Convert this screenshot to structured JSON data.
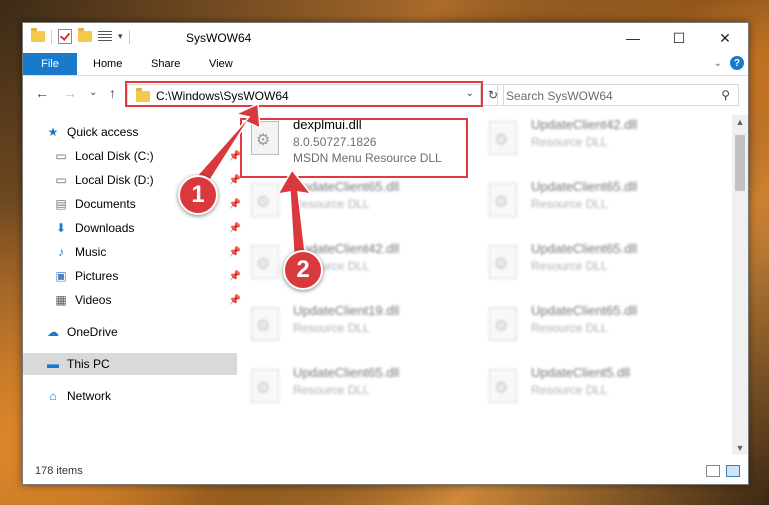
{
  "window": {
    "title": "SysWOW64",
    "controls": {
      "minimize": "—",
      "maximize": "☐",
      "close": "✕"
    }
  },
  "ribbon": {
    "tabs": [
      {
        "label": "File"
      },
      {
        "label": "Home"
      },
      {
        "label": "Share"
      },
      {
        "label": "View"
      }
    ],
    "help_label": "?",
    "collapse_glyph": "⌄"
  },
  "nav": {
    "back": "←",
    "forward": "→",
    "recent": "⌄",
    "up": "↑",
    "address": "C:\\Windows\\SysWOW64",
    "address_chevron": "⌄",
    "refresh": "↻",
    "search_placeholder": "Search SysWOW64",
    "search_glyph": "⚲"
  },
  "sidebar": {
    "items": [
      {
        "label": "Quick access",
        "icon": "star-icon",
        "glyph": "★",
        "pinned": false
      },
      {
        "label": "Local Disk (C:)",
        "icon": "drive-icon",
        "glyph": "▭",
        "pinned": true
      },
      {
        "label": "Local Disk (D:)",
        "icon": "drive-icon",
        "glyph": "▭",
        "pinned": true
      },
      {
        "label": "Documents",
        "icon": "documents-icon",
        "glyph": "▤",
        "pinned": true
      },
      {
        "label": "Downloads",
        "icon": "download-icon",
        "glyph": "⬇",
        "pinned": true
      },
      {
        "label": "Music",
        "icon": "music-icon",
        "glyph": "♪",
        "pinned": true
      },
      {
        "label": "Pictures",
        "icon": "pictures-icon",
        "glyph": "▣",
        "pinned": true
      },
      {
        "label": "Videos",
        "icon": "video-icon",
        "glyph": "▦",
        "pinned": true
      },
      {
        "label": "OneDrive",
        "icon": "cloud-icon",
        "glyph": "☁",
        "pinned": false
      },
      {
        "label": "This PC",
        "icon": "computer-icon",
        "glyph": "▬",
        "pinned": false,
        "selected": true
      },
      {
        "label": "Network",
        "icon": "network-icon",
        "glyph": "⌂",
        "pinned": false
      }
    ],
    "pin_glyph": "📌"
  },
  "files": {
    "highlighted": {
      "name": "dexplmui.dll",
      "version": "8.0.50727.1826",
      "description": "MSDN Menu Resource DLL"
    },
    "others": [
      {
        "name": "UpdateClient42.dll",
        "type": "Resource DLL"
      },
      {
        "name": "UpdateClient65.dll",
        "type": "Resource DLL"
      },
      {
        "name": "UpdateClient65.dll",
        "type": "Resource DLL"
      },
      {
        "name": "UpdateClient42.dll",
        "type": "Resource DLL"
      },
      {
        "name": "UpdateClient65.dll",
        "type": "Resource DLL"
      },
      {
        "name": "UpdateClient19.dll",
        "type": "Resource DLL"
      },
      {
        "name": "UpdateClient65.dll",
        "type": "Resource DLL"
      },
      {
        "name": "UpdateClient65.dll",
        "type": "Resource DLL"
      },
      {
        "name": "UpdateClient5.dll",
        "type": "Resource DLL"
      }
    ]
  },
  "scrollbar": {
    "up": "▲",
    "down": "▼"
  },
  "status": {
    "items_count": "178 items"
  },
  "callouts": [
    {
      "label": "1"
    },
    {
      "label": "2"
    }
  ],
  "colors": {
    "accent": "#1979ca",
    "highlight": "#e0393e"
  }
}
